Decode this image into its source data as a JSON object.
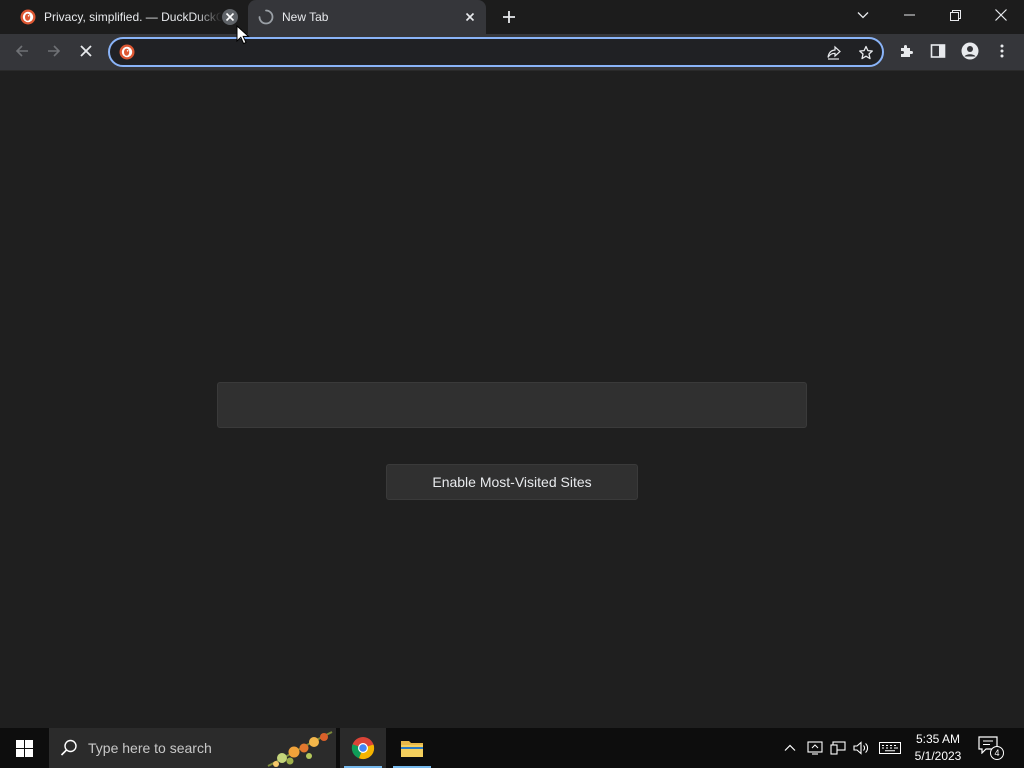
{
  "tabs": [
    {
      "title": "Privacy, simplified. — DuckDuckGo",
      "state": "inactive"
    },
    {
      "title": "New Tab",
      "state": "active-loading"
    }
  ],
  "omnibox": {
    "value": "",
    "placeholder": ""
  },
  "content": {
    "enable_button_label": "Enable Most-Visited Sites"
  },
  "taskbar": {
    "search_placeholder": "Type here to search",
    "time": "5:35 AM",
    "date": "5/1/2023",
    "notification_count": "4"
  },
  "colors": {
    "focus_ring": "#8ab4f8",
    "page_background": "#1f1f1f",
    "toolbar": "#35363a",
    "duckduckgo_orange": "#de5833"
  },
  "icons": [
    "duckduckgo-icon",
    "loading-spinner-icon",
    "close-icon",
    "plus-icon",
    "chevron-down-icon",
    "minimize-icon",
    "restore-icon",
    "back-icon",
    "forward-icon",
    "stop-icon",
    "share-icon",
    "star-icon",
    "extensions-icon",
    "side-panel-icon",
    "profile-icon",
    "kebab-menu-icon",
    "windows-icon",
    "search-icon",
    "chrome-icon",
    "folder-icon",
    "chevron-up-icon",
    "network-icon",
    "volume-icon",
    "keyboard-icon",
    "notification-icon"
  ]
}
